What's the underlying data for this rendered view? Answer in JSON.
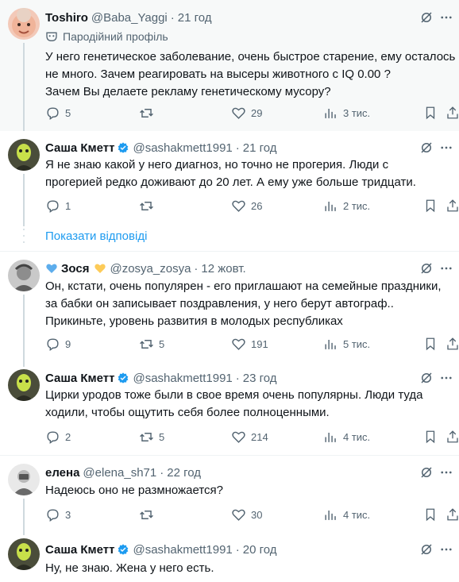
{
  "colors": {
    "accent": "#1d9bf0",
    "muted": "#536471",
    "text": "#0f1419",
    "verified": "#1d9bf0"
  },
  "tweets": [
    {
      "name": "Toshiro",
      "handle": "@Baba_Yaggi",
      "dot": "·",
      "time": "21 год",
      "parody_label": "Пародійний профіль",
      "lines": [
        "У него генетическое заболевание, очень быстрое старение, ему осталось",
        "не много. Зачем реагировать на высеры животного с IQ 0.00 ?",
        "Зачем Вы делаете рекламу генетическому мусору?"
      ],
      "replies": "5",
      "reposts": "",
      "likes": "29",
      "views": "3 тис."
    },
    {
      "name": "Саша Кметт",
      "handle": "@sashakmett1991",
      "dot": "·",
      "time": "21 год",
      "lines": [
        "Я не знаю какой у него диагноз, но точно не прогерия. Люди с",
        "прогерией редко доживают до 20 лет. А ему уже больше тридцати."
      ],
      "replies": "1",
      "reposts": "",
      "likes": "26",
      "views": "2 тис."
    },
    {
      "name": "Зося",
      "handle": "@zosya_zosya",
      "dot": "·",
      "time": "12 жовт.",
      "lines": [
        "Он, кстати, очень популярен - его приглашают на семейные праздники,",
        "за бабки он записывает поздравления, у него берут автограф..",
        "Прикиньте, уровень развития в молодых республиках"
      ],
      "replies": "9",
      "reposts": "5",
      "likes": "191",
      "views": "5 тис."
    },
    {
      "name": "Саша Кметт",
      "handle": "@sashakmett1991",
      "dot": "·",
      "time": "23 год",
      "lines": [
        "Цирки уродов тоже были в свое время очень  популярны. Люди туда",
        "ходили, чтобы ощутить себя более полноценными."
      ],
      "replies": "2",
      "reposts": "5",
      "likes": "214",
      "views": "4 тис."
    },
    {
      "name": "елена",
      "handle": "@elena_sh71",
      "dot": "·",
      "time": "22 год",
      "lines": [
        "Надеюсь оно не размножается?"
      ],
      "replies": "3",
      "reposts": "",
      "likes": "30",
      "views": "4 тис."
    },
    {
      "name": "Саша Кметт",
      "handle": "@sashakmett1991",
      "dot": "·",
      "time": "20 год",
      "lines": [
        "Ну, не знаю. Жена у него есть."
      ]
    }
  ],
  "show_replies": "Показати відповіді"
}
